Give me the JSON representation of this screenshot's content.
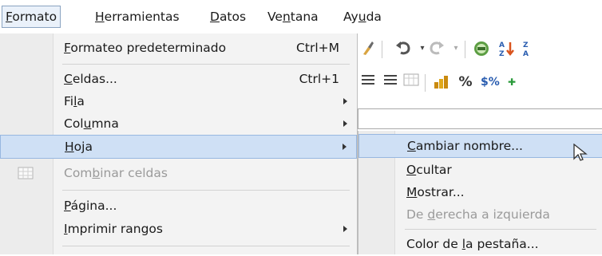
{
  "menubar": {
    "items": [
      {
        "pre": "",
        "u": "F",
        "post": "ormato"
      },
      {
        "pre": "",
        "u": "H",
        "post": "erramientas"
      },
      {
        "pre": "",
        "u": "D",
        "post": "atos"
      },
      {
        "pre": "Ve",
        "u": "n",
        "post": "tana"
      },
      {
        "pre": "Ay",
        "u": "u",
        "post": "da"
      }
    ]
  },
  "menu": {
    "items": [
      {
        "pre": "",
        "u": "F",
        "post": "ormateo predeterminado",
        "shortcut": "Ctrl+M"
      },
      {
        "pre": "",
        "u": "C",
        "post": "eldas...",
        "shortcut": "Ctrl+1"
      },
      {
        "pre": "Fi",
        "u": "l",
        "post": "a",
        "shortcut": ""
      },
      {
        "pre": "Col",
        "u": "u",
        "post": "mna",
        "shortcut": ""
      },
      {
        "pre": "",
        "u": "H",
        "post": "oja",
        "shortcut": ""
      },
      {
        "pre": "Com",
        "u": "b",
        "post": "inar celdas",
        "shortcut": ""
      },
      {
        "pre": "",
        "u": "P",
        "post": "ágina...",
        "shortcut": ""
      },
      {
        "pre": "",
        "u": "I",
        "post": "mprimir rangos",
        "shortcut": ""
      }
    ]
  },
  "submenu": {
    "items": [
      {
        "pre": "",
        "u": "C",
        "post": "ambiar nombre..."
      },
      {
        "pre": "",
        "u": "O",
        "post": "cultar"
      },
      {
        "pre": "",
        "u": "M",
        "post": "ostrar..."
      },
      {
        "pre": "De ",
        "u": "d",
        "post": "erecha a izquierda"
      },
      {
        "pre": "Color de ",
        "u": "l",
        "post": "a pestaña..."
      }
    ]
  },
  "toolbar": {
    "icons_row1": [
      "brush-icon",
      "undo-icon",
      "redo-icon",
      "navigator-icon",
      "sort-ascending-icon",
      "sort-descending-icon"
    ],
    "icons_row2": [
      "align-center-icon",
      "align-right-icon",
      "merge-cells-icon",
      "currency-icon",
      "percent-icon",
      "currency-format-icon",
      "add-decimal-icon"
    ],
    "percent_glyph": "%",
    "currency_glyph": "$%",
    "sort_az": "A↓Z",
    "sort_za": "Z↓A"
  },
  "colors": {
    "highlight": "#cfe0f5",
    "highlight_border": "#97b7e0",
    "menu_bg": "#f3f3f3"
  }
}
